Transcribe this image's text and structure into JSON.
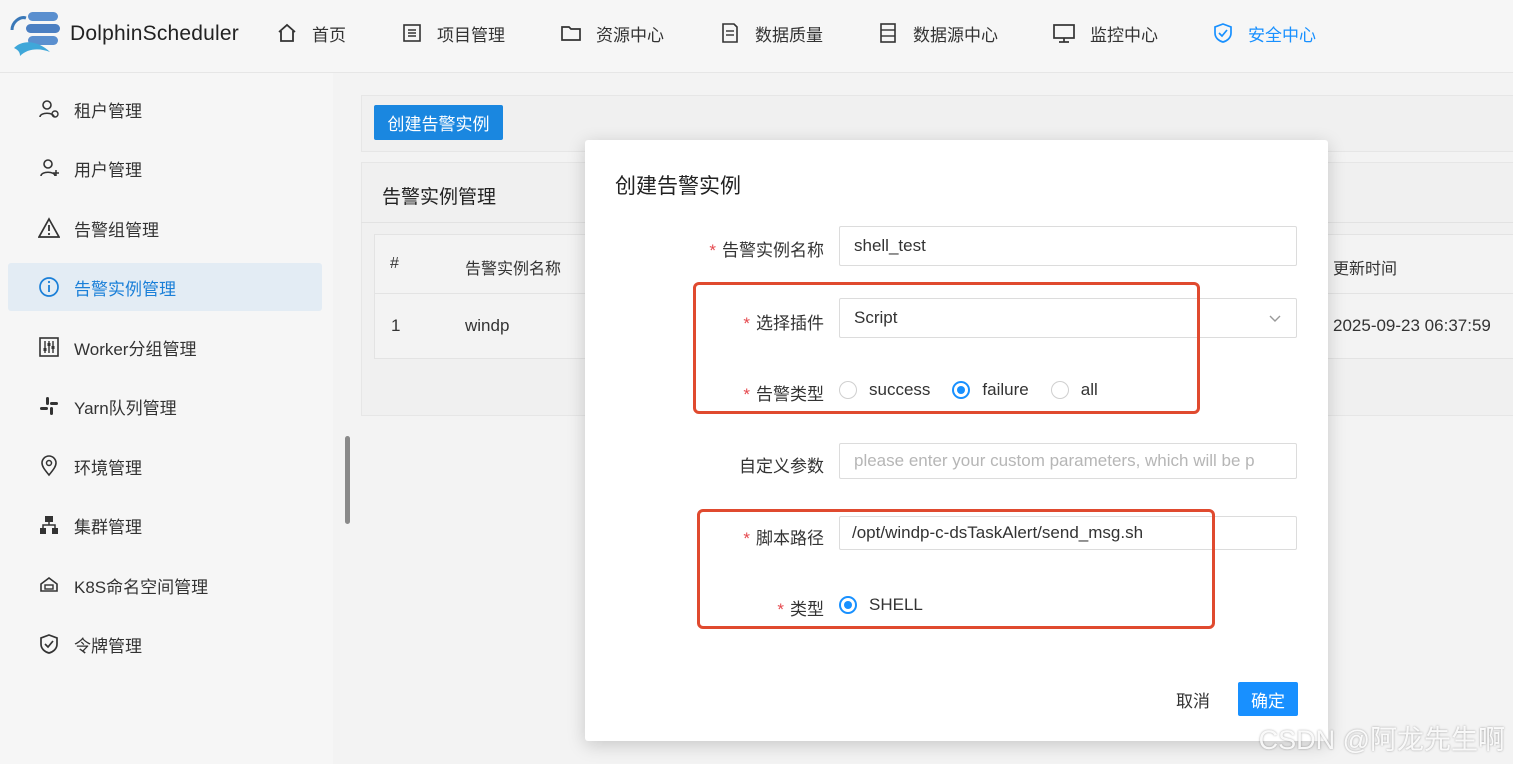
{
  "header": {
    "brand": "DolphinScheduler",
    "nav": [
      {
        "label": "首页",
        "icon": "home-icon"
      },
      {
        "label": "项目管理",
        "icon": "list-icon"
      },
      {
        "label": "资源中心",
        "icon": "folder-icon"
      },
      {
        "label": "数据质量",
        "icon": "document-icon"
      },
      {
        "label": "数据源中心",
        "icon": "database-icon"
      },
      {
        "label": "监控中心",
        "icon": "monitor-icon"
      },
      {
        "label": "安全中心",
        "icon": "shield-icon"
      }
    ],
    "active_nav": "安全中心",
    "accent_color": "#1890ff"
  },
  "sidebar": {
    "items": [
      {
        "label": "租户管理",
        "icon": "tenant-icon"
      },
      {
        "label": "用户管理",
        "icon": "user-icon"
      },
      {
        "label": "告警组管理",
        "icon": "warning-icon"
      },
      {
        "label": "告警实例管理",
        "icon": "info-icon"
      },
      {
        "label": "Worker分组管理",
        "icon": "sliders-icon"
      },
      {
        "label": "Yarn队列管理",
        "icon": "slack-icon"
      },
      {
        "label": "环境管理",
        "icon": "location-icon"
      },
      {
        "label": "集群管理",
        "icon": "cluster-icon"
      },
      {
        "label": "K8S命名空间管理",
        "icon": "k8s-icon"
      },
      {
        "label": "令牌管理",
        "icon": "shield-check-icon"
      }
    ],
    "active": "告警实例管理"
  },
  "main": {
    "create_button": "创建告警实例",
    "list_title": "告警实例管理",
    "table": {
      "headers": [
        "#",
        "告警实例名称",
        "更新时间"
      ],
      "rows": [
        {
          "index": "1",
          "name": "windp",
          "updated": "2025-09-23 06:37:59"
        }
      ]
    }
  },
  "modal": {
    "title": "创建告警实例",
    "fields": {
      "instance_name": {
        "label": "告警实例名称",
        "value": "shell_test"
      },
      "plugin": {
        "label": "选择插件",
        "value": "Script"
      },
      "alert_type": {
        "label": "告警类型",
        "options": [
          "success",
          "failure",
          "all"
        ],
        "selected": "failure"
      },
      "custom_params": {
        "label": "自定义参数",
        "placeholder": "please enter your custom parameters, which will be p"
      },
      "script_path": {
        "label": "脚本路径",
        "value": "/opt/windp-c-dsTaskAlert/send_msg.sh"
      },
      "type": {
        "label": "类型",
        "options": [
          "SHELL"
        ],
        "selected": "SHELL"
      }
    },
    "required_mark": "*",
    "cancel": "取消",
    "confirm": "确定"
  },
  "watermark": "CSDN @阿龙先生啊"
}
